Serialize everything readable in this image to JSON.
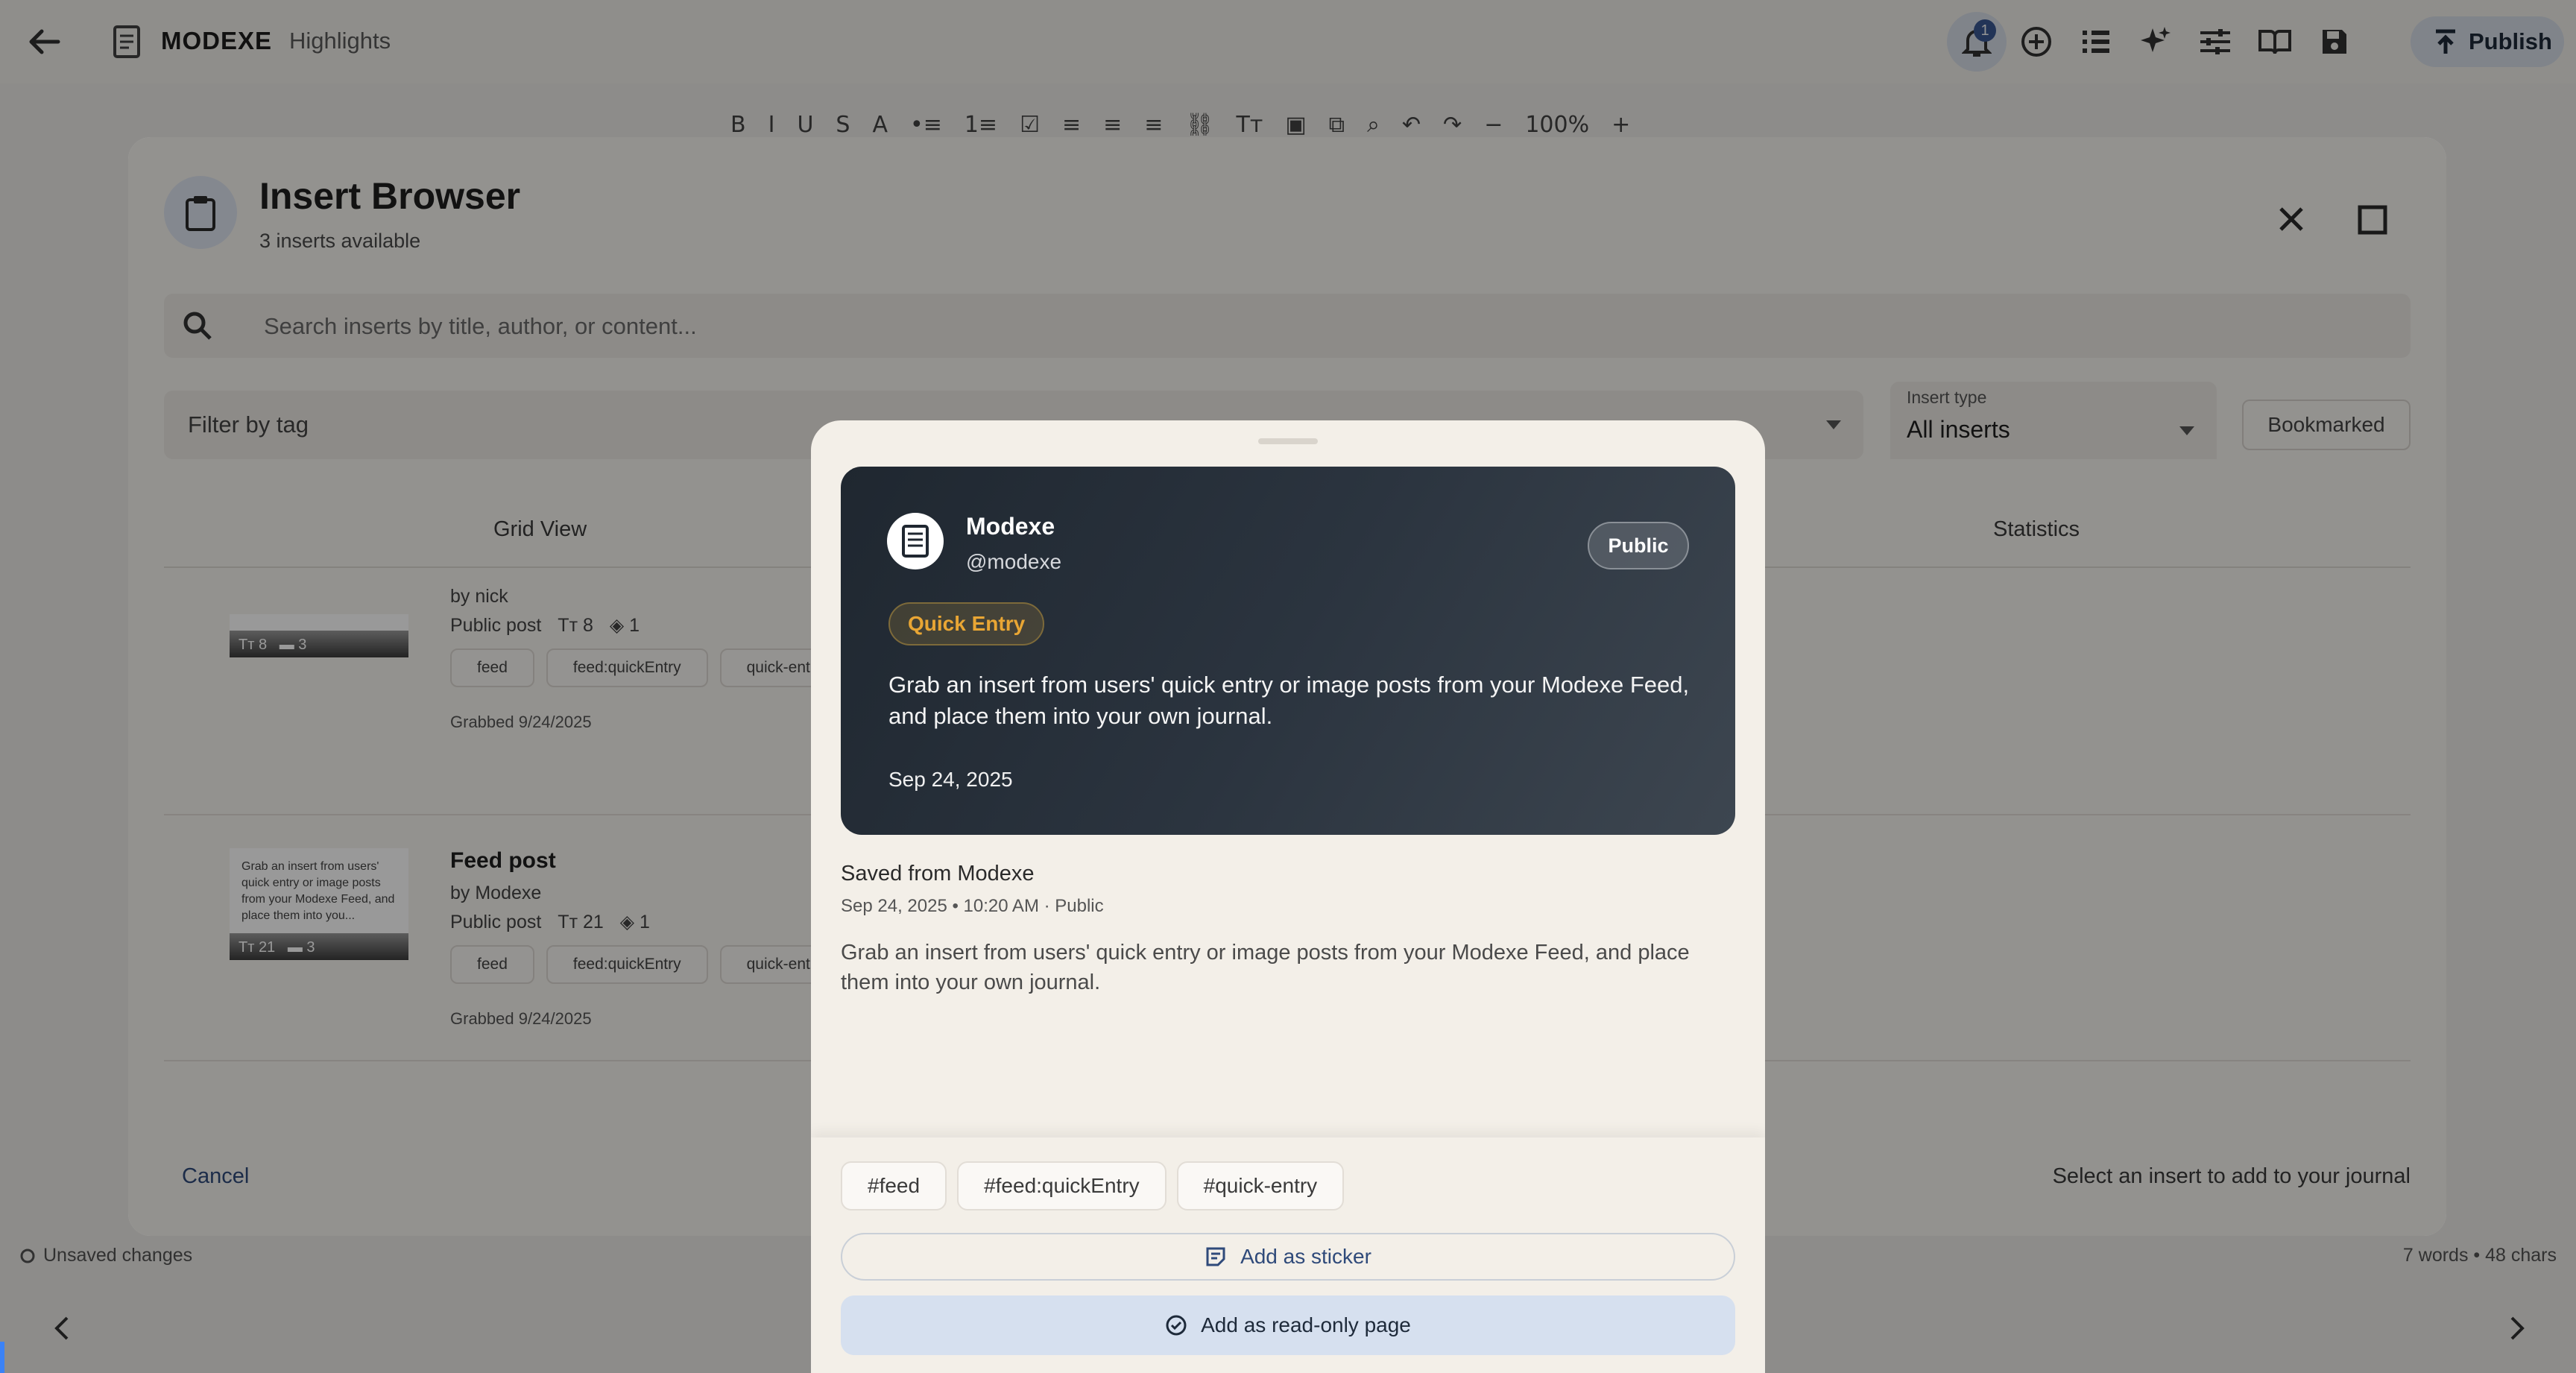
{
  "app": {
    "title": "MODEXE",
    "section": "Highlights",
    "notification_count": "1",
    "publish_label": "Publish",
    "zoom": "100%",
    "toolbar_glyphs": [
      "B",
      "I",
      "U",
      "S",
      "A",
      "•≡",
      "1≡",
      "☑",
      "≡",
      "≡",
      "≡",
      "⛓",
      "Tт",
      "▣",
      "⧉",
      "⌕",
      "↶",
      "↷",
      "−",
      "100%",
      "+"
    ],
    "status_left": "Unsaved changes",
    "status_right": "7 words • 48 chars"
  },
  "dialog": {
    "title": "Insert Browser",
    "subtitle": "3 inserts available",
    "search_placeholder": "Search inserts by title, author, or content...",
    "filter_placeholder": "Filter by tag",
    "insert_type_label": "Insert type",
    "insert_type_value": "All inserts",
    "bookmarked_label": "Bookmarked",
    "tabs": [
      "Grid View",
      "Statistics"
    ],
    "rows": [
      {
        "title": "",
        "author": "by nick",
        "meta": "Public post",
        "words": "8",
        "layers": "1",
        "thumb_words": "8",
        "thumb_comments": "3",
        "tags": [
          "feed",
          "feed:quickEntry",
          "quick-entry"
        ],
        "grabbed": "Grabbed 9/24/2025"
      },
      {
        "title": "Feed post",
        "author": "by Modexe",
        "meta": "Public post",
        "words": "21",
        "layers": "1",
        "thumb_text": "Grab an insert from users' quick entry or image posts from your Modexe Feed, and place them into you...",
        "thumb_words": "21",
        "thumb_comments": "3",
        "tags": [
          "feed",
          "feed:quickEntry",
          "quick-entry"
        ],
        "grabbed": "Grabbed 9/24/2025"
      }
    ],
    "cancel_label": "Cancel",
    "hint": "Select an insert to add to your journal"
  },
  "preview": {
    "name": "Modexe",
    "handle": "@modexe",
    "visibility": "Public",
    "type_badge": "Quick Entry",
    "body": "Grab an insert from users' quick entry or image posts from your Modexe Feed, and place them into your own journal.",
    "date": "Sep 24, 2025",
    "saved_from": "Saved from Modexe",
    "saved_meta": "Sep 24, 2025 • 10:20 AM · Public",
    "saved_body": "Grab an insert from users' quick entry or image posts from your Modexe Feed, and place them into your own journal.",
    "tags": [
      "#feed",
      "#feed:quickEntry",
      "#quick-entry"
    ],
    "sticker_label": "Add as sticker",
    "readonly_label": "Add as read-only page"
  },
  "colors": {
    "accent": "#2f4a7a",
    "badge_gold": "#e9a634",
    "hero_dark": "#2b343f"
  }
}
